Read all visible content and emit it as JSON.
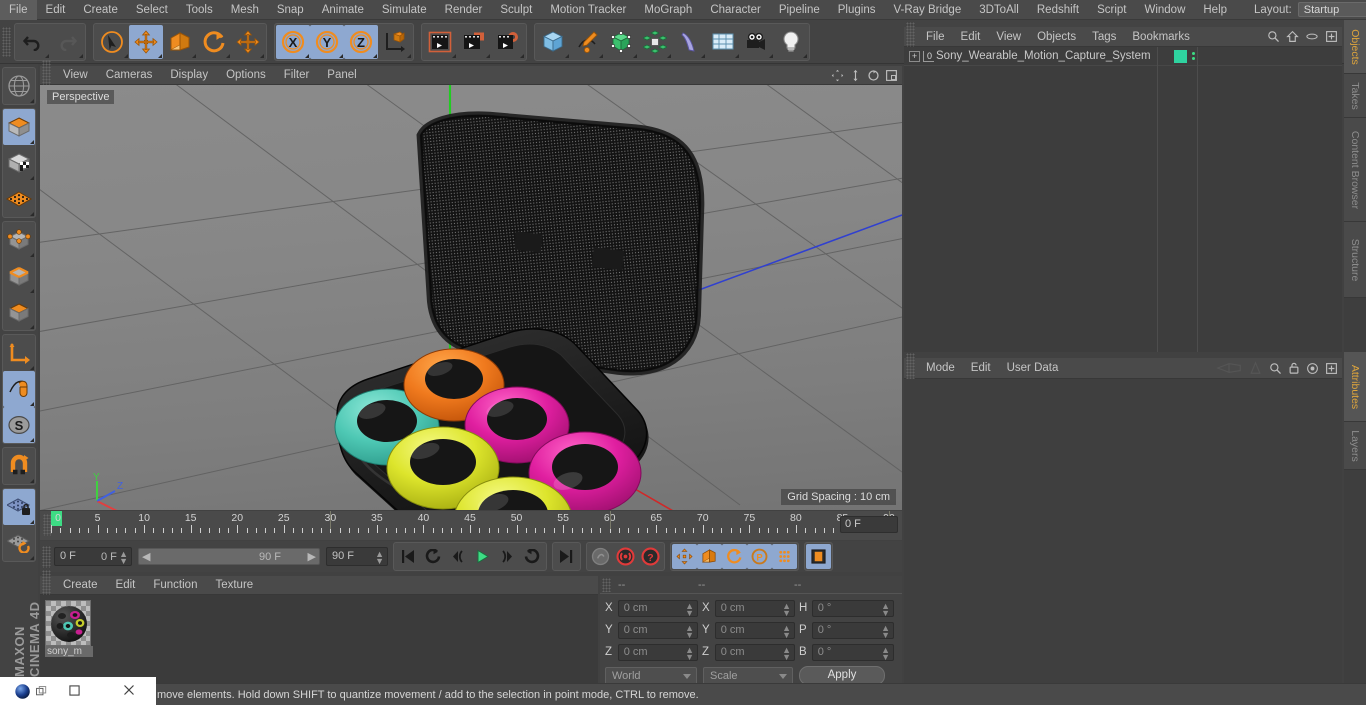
{
  "app": {
    "brand_line1": "MAXON",
    "brand_line2": "CINEMA 4D"
  },
  "menubar": {
    "items": [
      "File",
      "Edit",
      "Create",
      "Select",
      "Tools",
      "Mesh",
      "Snap",
      "Animate",
      "Simulate",
      "Render",
      "Sculpt",
      "Motion Tracker",
      "MoGraph",
      "Character",
      "Pipeline",
      "Plugins",
      "V-Ray Bridge",
      "3DToAll",
      "Redshift",
      "Script",
      "Window",
      "Help"
    ],
    "layout_label": "Layout:",
    "layout_value": "Startup",
    "search_icon": "search-icon"
  },
  "toolbar": {
    "groups": [
      {
        "name": "history",
        "buttons": [
          {
            "icon": "undo-icon",
            "label": "Undo",
            "active": false
          },
          {
            "icon": "redo-icon",
            "label": "Redo",
            "active": false
          }
        ]
      },
      {
        "name": "tools",
        "buttons": [
          {
            "icon": "select-live-icon",
            "label": "Live Selection",
            "active": false
          },
          {
            "icon": "move-icon",
            "label": "Move",
            "active": true
          },
          {
            "icon": "scale-icon",
            "label": "Scale",
            "active": false
          },
          {
            "icon": "rotate-icon",
            "label": "Rotate",
            "active": false
          },
          {
            "icon": "move-world-icon",
            "label": "Move World",
            "active": false
          }
        ]
      },
      {
        "name": "axis-lock",
        "buttons": [
          {
            "icon": "axis-x-icon",
            "label": "X Axis",
            "active": true
          },
          {
            "icon": "axis-y-icon",
            "label": "Y Axis",
            "active": true
          },
          {
            "icon": "axis-z-icon",
            "label": "Z Axis",
            "active": true
          },
          {
            "icon": "world-object-axis-icon",
            "label": "World / Object",
            "active": false
          }
        ]
      },
      {
        "name": "render",
        "buttons": [
          {
            "icon": "render-view-icon",
            "label": "Render View",
            "active": false
          },
          {
            "icon": "render-region-icon",
            "label": "Render to Picture Viewer",
            "active": false
          },
          {
            "icon": "render-settings-icon",
            "label": "Render Settings",
            "active": false
          }
        ]
      },
      {
        "name": "objects",
        "buttons": [
          {
            "icon": "cube-primitive-icon",
            "label": "Add Cube Object",
            "active": false
          },
          {
            "icon": "spline-pen-icon",
            "label": "Add Spline Object",
            "active": false
          },
          {
            "icon": "generator-icon",
            "label": "Add Generator Object",
            "active": false
          },
          {
            "icon": "array-icon",
            "label": "Add Modeling Object",
            "active": false
          },
          {
            "icon": "bend-deformer-icon",
            "label": "Add Deformer Object",
            "active": false
          },
          {
            "icon": "environment-icon",
            "label": "Add Scene Object",
            "active": false
          },
          {
            "icon": "camera-icon",
            "label": "Add Camera Object",
            "active": false
          },
          {
            "icon": "light-icon",
            "label": "Add Light Object",
            "active": false
          }
        ]
      }
    ]
  },
  "left_toolbar": {
    "buttons": [
      {
        "icon": "undo-view-icon",
        "label": "Undo View",
        "active": false
      },
      {
        "icon": "model-mode-icon",
        "label": "Model Mode",
        "active": true
      },
      {
        "icon": "texture-mode-icon",
        "label": "Texture Mode",
        "active": false
      },
      {
        "icon": "workplane-mode-icon",
        "label": "Workplane Mode",
        "active": false
      },
      {
        "icon": "points-mode-icon",
        "label": "Points Mode",
        "active": false
      },
      {
        "icon": "edges-mode-icon",
        "label": "Edges Mode",
        "active": false
      },
      {
        "icon": "polygons-mode-icon",
        "label": "Polygons Mode",
        "active": false
      },
      {
        "icon": "axis-modify-icon",
        "label": "Enable Axis Modification",
        "active": false
      },
      {
        "icon": "viewport-solo-icon",
        "label": "Viewport Solo Single",
        "active": true
      },
      {
        "icon": "soft-selection-icon",
        "label": "Enable Soft Selection",
        "active": true
      },
      {
        "icon": "snap-magnet-icon",
        "label": "Enable Snapping",
        "active": false
      },
      {
        "icon": "workplane-lock-icon",
        "label": "Lock Workplane",
        "active": true
      },
      {
        "icon": "workplane-reset-icon",
        "label": "Planar Workplane Mode",
        "active": false
      }
    ]
  },
  "viewport": {
    "menu": [
      "View",
      "Cameras",
      "Display",
      "Options",
      "Filter",
      "Panel"
    ],
    "view_label": "Perspective",
    "grid_spacing": "Grid Spacing : 10 cm",
    "axis_gizmo": {
      "x": "X",
      "y": "Y",
      "z": "Z",
      "x_color": "#e04040",
      "y_color": "#40d040",
      "z_color": "#4060e0"
    },
    "header_icons": [
      "pan-icon",
      "dolly-icon",
      "rotate-view-icon",
      "maximize-view-icon"
    ],
    "scene": {
      "objects": [
        {
          "name": "case-lid",
          "color": "#1b1b1b"
        },
        {
          "name": "case-base",
          "color": "#181818"
        },
        {
          "name": "sensor-teal",
          "color": "#4ec8b4"
        },
        {
          "name": "sensor-orange",
          "color": "#f07a1e"
        },
        {
          "name": "sensor-magenta-top",
          "color": "#e01fa0"
        },
        {
          "name": "sensor-yellow-mid",
          "color": "#e0e82a"
        },
        {
          "name": "sensor-magenta-right",
          "color": "#d61f96"
        },
        {
          "name": "sensor-yellow-front",
          "color": "#dde52c"
        }
      ]
    }
  },
  "timeline": {
    "ticks": [
      0,
      5,
      10,
      15,
      20,
      25,
      30,
      35,
      40,
      45,
      50,
      55,
      60,
      65,
      70,
      75,
      80,
      85,
      90
    ],
    "min": 0,
    "max": 90,
    "current_frame": "0 F",
    "end_field": "0 F"
  },
  "transport": {
    "frame_field": "0 F",
    "range_start": "0 F",
    "range_end": "90 F",
    "max_field": "90 F",
    "buttons": [
      {
        "icon": "go-to-start-icon",
        "label": "Go to Start",
        "active": false
      },
      {
        "icon": "step-back-keyframe-icon",
        "label": "Go to Previous Key",
        "active": false
      },
      {
        "icon": "step-back-frame-icon",
        "label": "Go to Previous Frame",
        "active": false
      },
      {
        "icon": "play-icon",
        "label": "Play Forwards",
        "active": false
      },
      {
        "icon": "step-forward-frame-icon",
        "label": "Go to Next Frame",
        "active": false
      },
      {
        "icon": "step-forward-keyframe-icon",
        "label": "Go to Next Key",
        "active": false
      },
      {
        "icon": "go-to-end-icon",
        "label": "Go to End",
        "active": false
      },
      {
        "icon": "record-active-objects-icon",
        "label": "Record Active Objects",
        "active": false
      },
      {
        "icon": "autokeying-icon",
        "label": "Autokeying",
        "active": false
      },
      {
        "icon": "keyframe-selection-icon",
        "label": "Keyframe Selection",
        "active": false
      },
      {
        "icon": "position-key-icon",
        "label": "Position",
        "active": true
      },
      {
        "icon": "scale-key-icon",
        "label": "Scale",
        "active": true
      },
      {
        "icon": "rotation-key-icon",
        "label": "Rotation",
        "active": true
      },
      {
        "icon": "pla-key-icon",
        "label": "Point Level Animation",
        "active": true
      },
      {
        "icon": "param-key-icon",
        "label": "Parameter",
        "active": true
      },
      {
        "icon": "timeline-key-icon",
        "label": "Animation Mode",
        "active": true
      }
    ]
  },
  "material_manager": {
    "menu": [
      "Create",
      "Edit",
      "Function",
      "Texture"
    ],
    "materials": [
      {
        "name": "sony_m",
        "full_name": "sony_m"
      }
    ]
  },
  "coordinates": {
    "header": [
      "--",
      "--",
      "--"
    ],
    "rows": [
      {
        "pos_label": "X",
        "pos_value": "0 cm",
        "size_label": "X",
        "size_value": "0 cm",
        "rot_label": "H",
        "rot_value": "0 °"
      },
      {
        "pos_label": "Y",
        "pos_value": "0 cm",
        "size_label": "Y",
        "size_value": "0 cm",
        "rot_label": "P",
        "rot_value": "0 °"
      },
      {
        "pos_label": "Z",
        "pos_value": "0 cm",
        "size_label": "Z",
        "size_value": "0 cm",
        "rot_label": "B",
        "rot_value": "0 °"
      }
    ],
    "system_dropdown": "World",
    "mode_dropdown": "Scale",
    "apply_label": "Apply"
  },
  "object_manager": {
    "menu": [
      "File",
      "Edit",
      "View",
      "Objects",
      "Tags",
      "Bookmarks"
    ],
    "header_icons": [
      "search-icon",
      "home-icon",
      "ellipse-icon",
      "add-layer-icon"
    ],
    "items": [
      {
        "expand": "+",
        "level_badge": "0",
        "name": "Sony_Wearable_Motion_Capture_System",
        "tag_color": "#2fd3a0"
      }
    ]
  },
  "attribute_manager": {
    "menu": [
      "Mode",
      "Edit",
      "User Data"
    ],
    "header_icons": [
      "back-nav-icon",
      "forward-nav-icon",
      "search-icon",
      "lock-icon",
      "target-icon",
      "add-icon"
    ],
    "content": ""
  },
  "right_tabs": {
    "top_group": [
      {
        "label": "Objects",
        "active": true
      },
      {
        "label": "Takes",
        "active": false
      },
      {
        "label": "Content Browser",
        "active": false
      },
      {
        "label": "Structure",
        "active": false
      }
    ],
    "bottom_group": [
      {
        "label": "Attributes",
        "active": true
      },
      {
        "label": "Layers",
        "active": false
      }
    ]
  },
  "status_bar": {
    "text": "move elements. Hold down SHIFT to quantize movement / add to the selection in point mode, CTRL to remove."
  },
  "taskbar": {
    "app_icon": "cinema4d-icon",
    "buttons": [
      "restore-icon",
      "close-icon"
    ]
  },
  "colors": {
    "accent_blue": "#8ea8d0",
    "orange": "#ef8c20",
    "green_playhead": "#3ddc84",
    "tab_active": "#e0a63c"
  }
}
